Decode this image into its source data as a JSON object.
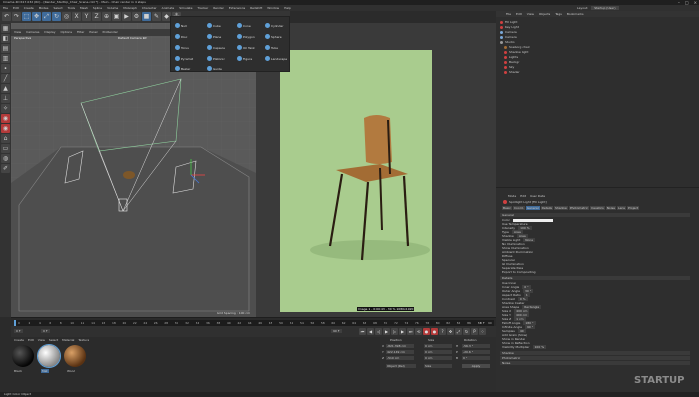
{
  "titlebar": {
    "title": "Cinema 4D R17.032 (RC) - [Render_StartUp_Chair_Scene.c4d *] - Main - Chair render in 4 steps"
  },
  "menubar": {
    "items": [
      "File",
      "Edit",
      "Create",
      "Modes",
      "Select",
      "Tools",
      "Mesh",
      "Spline",
      "Volume",
      "MoGraph",
      "Character",
      "Animate",
      "Simulate",
      "Tracker",
      "Render",
      "Extensions",
      "Redshift",
      "Window",
      "Help"
    ]
  },
  "layout": {
    "label": "Layout:",
    "value": "Startup (User)"
  },
  "toolbar": {
    "icons": [
      "undo-icon",
      "redo-icon",
      "select-icon",
      "move-icon",
      "scale-icon",
      "rotate-icon",
      "last-tool-icon",
      "axis-x-icon",
      "axis-y-icon",
      "axis-z-icon",
      "coordinate-system-icon",
      "render-view-icon",
      "render-picture-icon",
      "render-settings-icon",
      "cube-icon",
      "pen-icon",
      "subdivision-icon",
      "cloner-icon"
    ]
  },
  "viewport": {
    "menu": [
      "View",
      "Cameras",
      "Display",
      "Options",
      "Filter",
      "Panel",
      "ProRender"
    ],
    "name": "Perspective",
    "camera_label": "Default Camera ⊕▾",
    "grid_spacing": "Grid Spacing : 100 cm"
  },
  "render_view": {
    "caption": "Image 1 - 0:00:43 - 30 % 1080x1920"
  },
  "primitive_menu": {
    "items": [
      {
        "label": "Null",
        "icon": "null-icon"
      },
      {
        "label": "Cube",
        "icon": "cube-icon"
      },
      {
        "label": "Cone",
        "icon": "cone-icon"
      },
      {
        "label": "Cylinder",
        "icon": "cylinder-icon"
      },
      {
        "label": "Disc",
        "icon": "disc-icon"
      },
      {
        "label": "Plane",
        "icon": "plane-icon"
      },
      {
        "label": "Polygon",
        "icon": "polygon-icon"
      },
      {
        "label": "Sphere",
        "icon": "sphere-icon"
      },
      {
        "label": "Torus",
        "icon": "torus-icon"
      },
      {
        "label": "Capsule",
        "icon": "capsule-icon"
      },
      {
        "label": "Oil Tank",
        "icon": "oil-tank-icon"
      },
      {
        "label": "Tube",
        "icon": "tube-icon"
      },
      {
        "label": "Pyramid",
        "icon": "pyramid-icon"
      },
      {
        "label": "Platonic",
        "icon": "platonic-icon"
      },
      {
        "label": "Figure",
        "icon": "figure-icon"
      },
      {
        "label": "Landscape",
        "icon": "landscape-icon"
      },
      {
        "label": "Bezier",
        "icon": "bezier-icon"
      },
      {
        "label": "Guide",
        "icon": "guide-icon"
      }
    ]
  },
  "object_manager": {
    "menu": [
      "File",
      "Edit",
      "View",
      "Objects",
      "Tags",
      "Bookmarks"
    ],
    "objects": [
      {
        "name": "Fill Light"
      },
      {
        "name": "Key Light"
      },
      {
        "name": "Camera"
      },
      {
        "name": "Camera"
      },
      {
        "name": "Studio"
      },
      {
        "name": "Soeborg chair"
      },
      {
        "name": "Shadow light"
      },
      {
        "name": "Lights"
      },
      {
        "name": "Backgr"
      },
      {
        "name": "Sky"
      },
      {
        "name": "Shader"
      }
    ]
  },
  "attribute_manager": {
    "menu": [
      "Mode",
      "Edit",
      "User Data"
    ],
    "title": "Spotlight Light [Fill Light]",
    "tabs": [
      "Basic",
      "Coord.",
      "General",
      "Details",
      "Shadow",
      "Photometric",
      "Caustics",
      "Noise",
      "Lens",
      "Project"
    ],
    "sections": {
      "general": "General",
      "details": "Details",
      "shadow": "Shadow",
      "photometric": "Photometric",
      "noise": "Noise"
    },
    "general_fields": [
      {
        "label": "Color",
        "value": ""
      },
      {
        "label": "Use Temperature",
        "value": ""
      },
      {
        "label": "Intensity",
        "value": "100 %"
      },
      {
        "label": "Type",
        "value": "Area"
      },
      {
        "label": "Shadow",
        "value": "Area"
      },
      {
        "label": "Visible Light",
        "value": "None"
      },
      {
        "label": "No Illumination",
        "value": ""
      },
      {
        "label": "Show Illumination",
        "value": ""
      },
      {
        "label": "Ambient Illumination",
        "value": ""
      },
      {
        "label": "Diffuse",
        "value": ""
      },
      {
        "label": "Specular",
        "value": ""
      },
      {
        "label": "GI Illumination",
        "value": ""
      },
      {
        "label": "Separate Pass",
        "value": ""
      },
      {
        "label": "Export to Compositing",
        "value": ""
      }
    ],
    "detail_fields": [
      {
        "label": "Use Inner",
        "value": ""
      },
      {
        "label": "Inner Angle",
        "value": "0 °"
      },
      {
        "label": "Outer Angle",
        "value": "30 °"
      },
      {
        "label": "Aspect Ratio",
        "value": "1"
      },
      {
        "label": "Contrast",
        "value": "0 %"
      },
      {
        "label": "Shadow Caster",
        "value": ""
      },
      {
        "label": "Area Shape",
        "value": "Rectangle"
      },
      {
        "label": "Size X",
        "value": "400 cm"
      },
      {
        "label": "Size Y",
        "value": "400 cm"
      },
      {
        "label": "Size Z",
        "value": "1 cm"
      },
      {
        "label": "Falloff Angle",
        "value": "180 °"
      },
      {
        "label": "Infinite Angle",
        "value": "90 °"
      },
      {
        "label": "Samples",
        "value": "40"
      },
      {
        "label": "Add Grain (Slow)",
        "value": ""
      },
      {
        "label": "Show in Render",
        "value": ""
      },
      {
        "label": "Show in Reflection",
        "value": ""
      },
      {
        "label": "Visibility Multiplier",
        "value": "100 %"
      }
    ]
  },
  "timeline": {
    "ticks": [
      "0",
      "2",
      "4",
      "6",
      "8",
      "10",
      "12",
      "14",
      "16",
      "18",
      "20",
      "22",
      "24",
      "26",
      "28",
      "30",
      "32",
      "34",
      "36",
      "38",
      "40",
      "42",
      "44",
      "46",
      "48",
      "50",
      "52",
      "54",
      "56",
      "58",
      "60",
      "62",
      "64",
      "66",
      "68",
      "70",
      "72",
      "74",
      "76",
      "78",
      "80",
      "82",
      "84",
      "86",
      "88",
      "90"
    ],
    "end_frame": "0 F",
    "current_frame": "0 F",
    "start_field": "0 F",
    "end_field": "90 F"
  },
  "material_manager": {
    "menu": [
      "Create",
      "Edit",
      "View",
      "Select",
      "Material",
      "Texture"
    ],
    "materials": [
      {
        "name": "Black"
      },
      {
        "name": "Mat"
      },
      {
        "name": "Wood"
      }
    ]
  },
  "coordinates": {
    "headers": [
      "Position",
      "Size",
      "Rotation"
    ],
    "rows": [
      {
        "axis": "X",
        "position": "-821.398 cm",
        "size": "0 cm",
        "rot_label": "H",
        "rotation": "-56.3 °"
      },
      {
        "axis": "Y",
        "position": "422.149 cm",
        "size": "0 cm",
        "rot_label": "P",
        "rotation": "-20.6 °"
      },
      {
        "axis": "Z",
        "position": "-510 cm",
        "size": "0 cm",
        "rot_label": "B",
        "rotation": "0 °"
      }
    ],
    "mode": "Object (Rel)",
    "size_mode": "Size",
    "apply": "Apply"
  },
  "statusbar": {
    "text": "Light Color Object"
  },
  "watermark": {
    "text": "STARTUP"
  },
  "colors": {
    "accent_blue": "#3f6b9a",
    "render_bg": "#a9cc8e",
    "selection_red": "#b33a3a"
  }
}
